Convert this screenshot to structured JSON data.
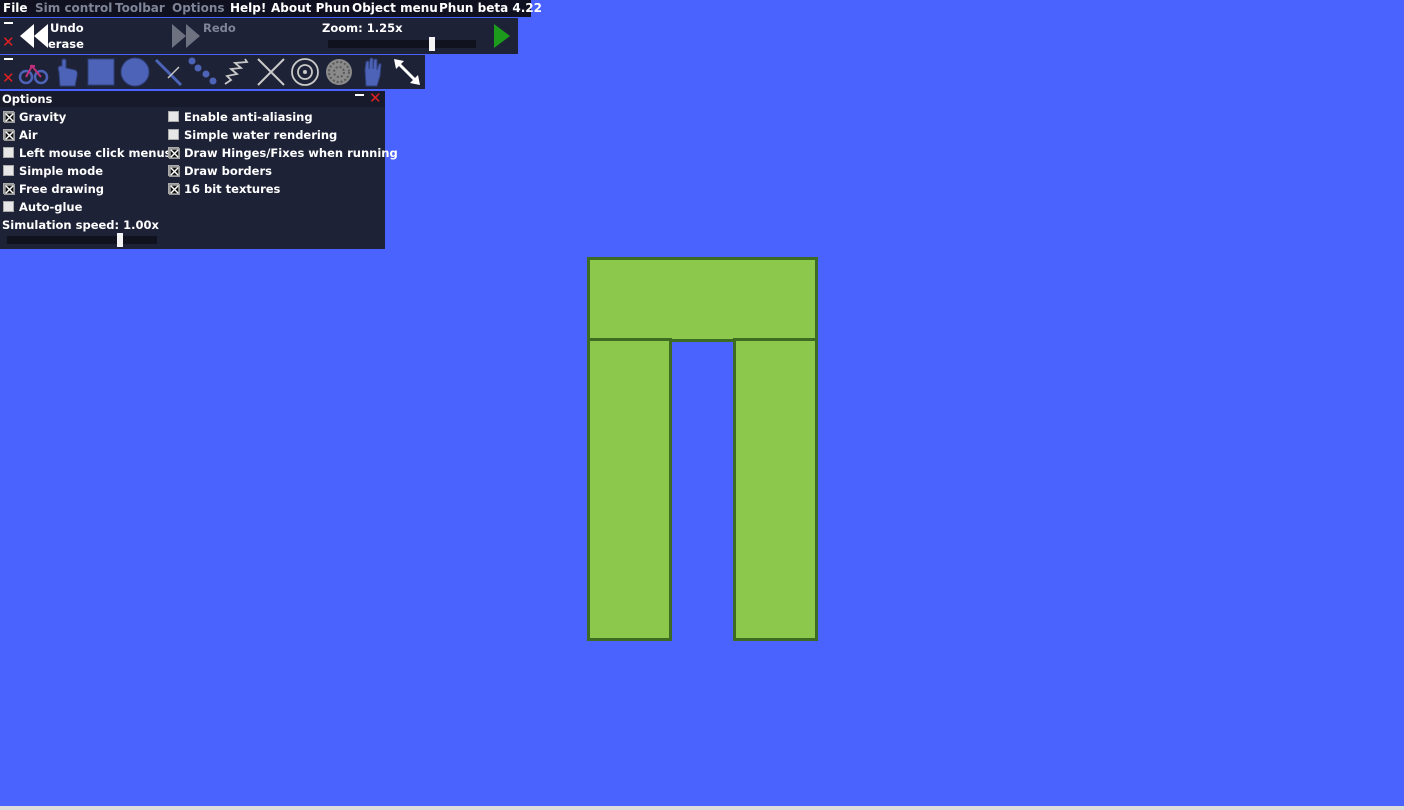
{
  "menubar": {
    "items": [
      {
        "label": "File",
        "enabled": true
      },
      {
        "label": "Sim control",
        "enabled": false
      },
      {
        "label": "Toolbar",
        "enabled": false
      },
      {
        "label": "Options",
        "enabled": false
      },
      {
        "label": "Help!",
        "enabled": true
      },
      {
        "label": "About Phun",
        "enabled": true
      },
      {
        "label": "Object menu",
        "enabled": true
      }
    ],
    "version": "Phun beta 4.22"
  },
  "sim_control": {
    "undo_label": "Undo",
    "undo_action": "erase",
    "redo_label": "Redo",
    "zoom_label": "Zoom: 1.25x",
    "zoom_slider_fraction": 0.7
  },
  "toolbar": {
    "tools": [
      "bicycle-icon",
      "hand-drag-icon",
      "box-icon",
      "circle-icon",
      "line-icon",
      "chain-icon",
      "spring-icon",
      "fixate-icon",
      "hinge-icon",
      "texture-icon",
      "glove-icon",
      "scale-icon"
    ],
    "active_tool": "scale-icon"
  },
  "options": {
    "title": "Options",
    "left_column": [
      {
        "label": "Gravity",
        "checked": true
      },
      {
        "label": "Air",
        "checked": true
      },
      {
        "label": "Left mouse click menus",
        "checked": false
      },
      {
        "label": "Simple mode",
        "checked": false
      },
      {
        "label": "Free drawing",
        "checked": true
      },
      {
        "label": "Auto-glue",
        "checked": false
      }
    ],
    "right_column": [
      {
        "label": "Enable anti-aliasing",
        "checked": false
      },
      {
        "label": "Simple water rendering",
        "checked": false
      },
      {
        "label": "Draw Hinges/Fixes when running",
        "checked": true
      },
      {
        "label": "Draw borders",
        "checked": true
      },
      {
        "label": "16 bit textures",
        "checked": true
      }
    ],
    "sim_speed_label": "Simulation speed: 1.00x",
    "sim_speed_slider_fraction": 0.75
  },
  "colors": {
    "background": "#4a63fe",
    "object_fill": "#8cc84b",
    "object_border": "#3d6b21",
    "close_red": "#e02020",
    "play_green": "#1c9a1c"
  }
}
